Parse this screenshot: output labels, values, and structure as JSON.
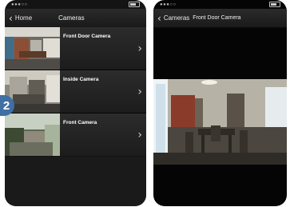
{
  "step_badge": "2",
  "left": {
    "back_label": "Home",
    "title": "Cameras",
    "cameras": [
      {
        "label": "Front Door Camera"
      },
      {
        "label": "Inside Camera"
      },
      {
        "label": "Front Camera"
      }
    ]
  },
  "right": {
    "back_label": "Cameras",
    "title": "Front Door Camera"
  },
  "colors": {
    "badge": "#3f6fa3",
    "navbar": "#222222",
    "list_bg": "#1a1a1a"
  }
}
